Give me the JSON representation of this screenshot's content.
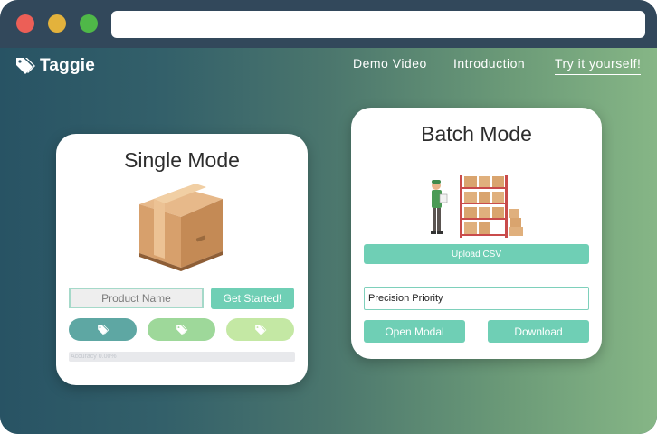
{
  "window": {
    "controls": [
      "close",
      "minimize",
      "maximize"
    ],
    "address_bar": ""
  },
  "header": {
    "brand": "Taggie",
    "nav": [
      "Demo Video",
      "Introduction",
      "Try it yourself!"
    ],
    "active_nav": "Try it yourself!"
  },
  "single_mode": {
    "title": "Single Mode",
    "image": "cardboard-box",
    "product_placeholder": "Product Name",
    "get_started": "Get Started!",
    "tag_buttons": [
      {
        "icon": "tags-icon",
        "color": "#5ea7a3"
      },
      {
        "icon": "tags-icon",
        "color": "#9ed89a"
      },
      {
        "icon": "tags-icon",
        "color": "#c4e8a4"
      }
    ],
    "accuracy_label": "Accuracy 0.00%",
    "accuracy_value": 0
  },
  "batch_mode": {
    "title": "Batch Mode",
    "image": "warehouse-worker-with-shelves",
    "upload_csv": "Upload CSV",
    "priority_select": "Precision Priority",
    "open_modal": "Open Modal",
    "download": "Download"
  },
  "colors": {
    "accent": "#6fcfb5",
    "titlebar": "#32485b"
  }
}
